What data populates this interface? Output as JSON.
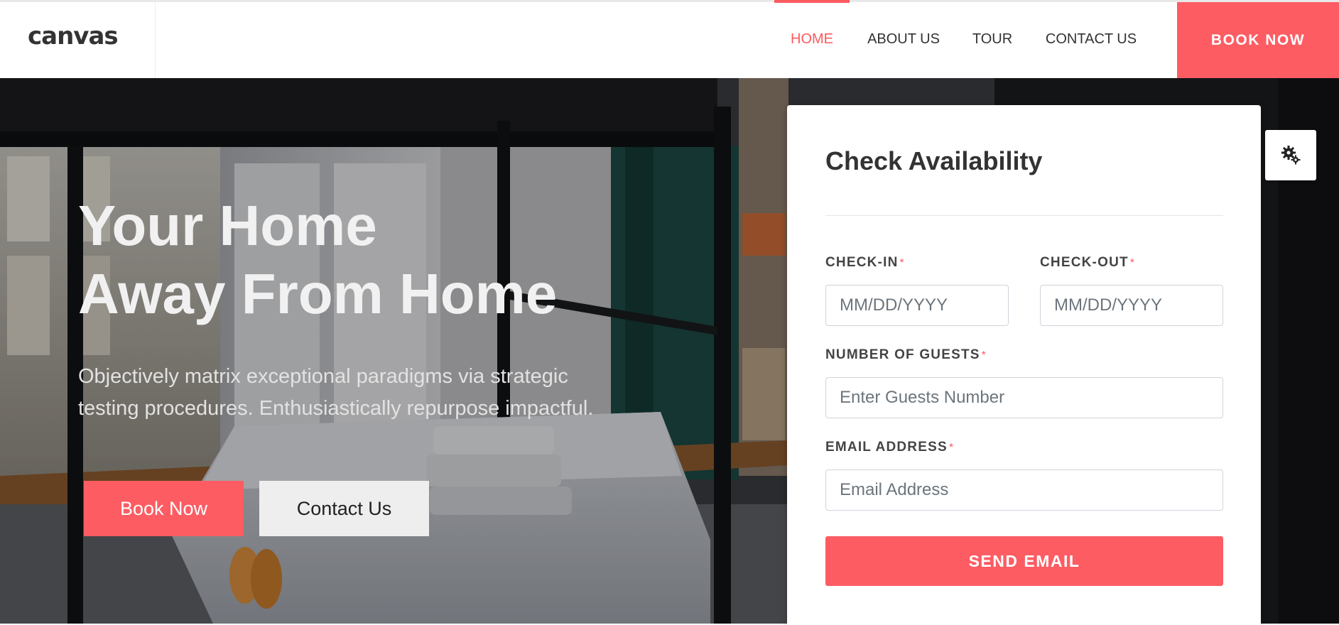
{
  "header": {
    "logo": "canvas",
    "nav": [
      {
        "label": "HOME",
        "active": true
      },
      {
        "label": "ABOUT US",
        "active": false
      },
      {
        "label": "TOUR",
        "active": false
      },
      {
        "label": "CONTACT US",
        "active": false
      }
    ],
    "book_button": "BOOK NOW"
  },
  "hero": {
    "title_line1": "Your Home",
    "title_line2": "Away From Home",
    "subtitle_line1": "Objectively matrix exceptional paradigms via strategic",
    "subtitle_line2": "testing procedures. Enthusiastically repurpose impactful.",
    "book_button": "Book Now",
    "contact_button": "Contact Us"
  },
  "form": {
    "title": "Check Availability",
    "checkin_label": "CHECK-IN",
    "checkin_placeholder": "MM/DD/YYYY",
    "checkout_label": "CHECK-OUT",
    "checkout_placeholder": "MM/DD/YYYY",
    "guests_label": "NUMBER OF GUESTS",
    "guests_placeholder": "Enter Guests Number",
    "email_label": "EMAIL ADDRESS",
    "email_placeholder": "Email Address",
    "required_mark": "*",
    "submit": "SEND EMAIL"
  },
  "icons": {
    "settings": "gear-icon"
  },
  "colors": {
    "accent": "#fd5c63",
    "text": "#333333"
  }
}
